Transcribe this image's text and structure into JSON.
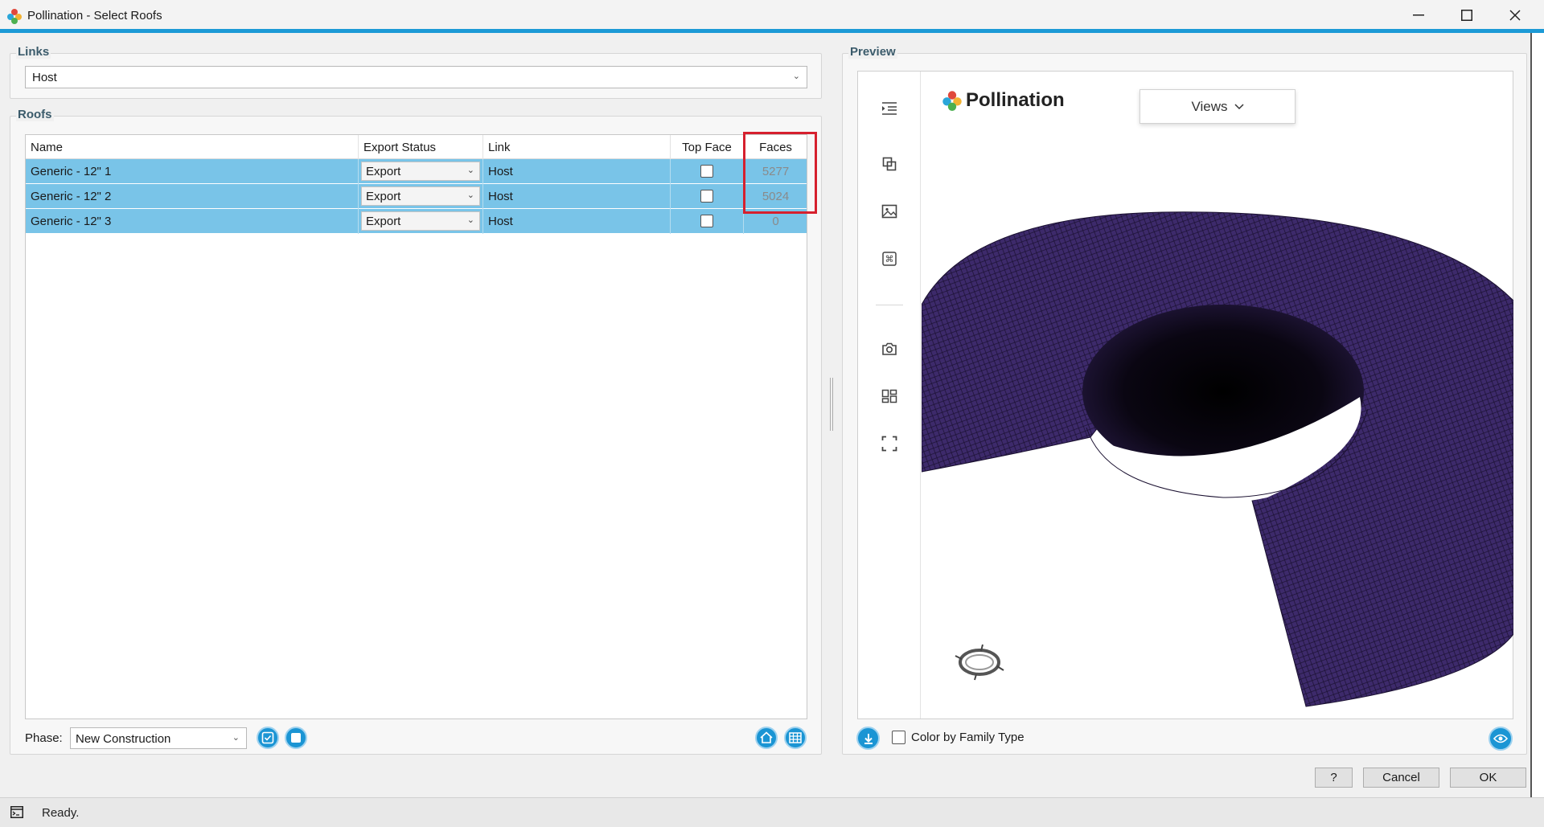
{
  "window": {
    "title": "Pollination - Select Roofs",
    "minimize_icon": "minimize-icon",
    "maximize_icon": "maximize-icon",
    "close_icon": "close-icon",
    "accent_color": "#1c9ad6"
  },
  "links": {
    "group_label": "Links",
    "selected": "Host"
  },
  "roofs": {
    "group_label": "Roofs",
    "columns": [
      "Name",
      "Export Status",
      "Link",
      "Top Face",
      "Faces"
    ],
    "rows": [
      {
        "name": "Generic - 12\" 1",
        "export_status": "Export",
        "link": "Host",
        "top_face": false,
        "faces": "5277"
      },
      {
        "name": "Generic - 12\" 2",
        "export_status": "Export",
        "link": "Host",
        "top_face": false,
        "faces": "5024"
      },
      {
        "name": "Generic - 12\" 3",
        "export_status": "Export",
        "link": "Host",
        "top_face": false,
        "faces": "0"
      }
    ],
    "row_color": "#79c4e8",
    "highlight_color": "#d6202e"
  },
  "phase": {
    "label": "Phase:",
    "selected": "New Construction"
  },
  "preview": {
    "group_label": "Preview",
    "logo_text": "Pollination",
    "views_label": "Views",
    "color_by_family_label": "Color by Family Type",
    "tools": [
      "list-indent-icon",
      "layers-icon",
      "image-icon",
      "command-icon",
      "camera-icon",
      "dashboard-icon",
      "fullscreen-icon"
    ],
    "mesh_color": "#3d2a6b"
  },
  "buttons": {
    "help": "?",
    "cancel": "Cancel",
    "ok": "OK"
  },
  "status": {
    "text": "Ready."
  }
}
